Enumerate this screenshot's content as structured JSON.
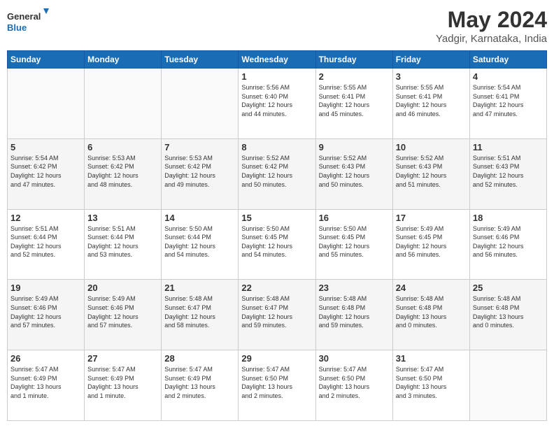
{
  "logo": {
    "line1": "General",
    "line2": "Blue"
  },
  "title": "May 2024",
  "subtitle": "Yadgir, Karnataka, India",
  "days_of_week": [
    "Sunday",
    "Monday",
    "Tuesday",
    "Wednesday",
    "Thursday",
    "Friday",
    "Saturday"
  ],
  "weeks": [
    [
      {
        "date": "",
        "info": ""
      },
      {
        "date": "",
        "info": ""
      },
      {
        "date": "",
        "info": ""
      },
      {
        "date": "1",
        "info": "Sunrise: 5:56 AM\nSunset: 6:40 PM\nDaylight: 12 hours\nand 44 minutes."
      },
      {
        "date": "2",
        "info": "Sunrise: 5:55 AM\nSunset: 6:41 PM\nDaylight: 12 hours\nand 45 minutes."
      },
      {
        "date": "3",
        "info": "Sunrise: 5:55 AM\nSunset: 6:41 PM\nDaylight: 12 hours\nand 46 minutes."
      },
      {
        "date": "4",
        "info": "Sunrise: 5:54 AM\nSunset: 6:41 PM\nDaylight: 12 hours\nand 47 minutes."
      }
    ],
    [
      {
        "date": "5",
        "info": "Sunrise: 5:54 AM\nSunset: 6:42 PM\nDaylight: 12 hours\nand 47 minutes."
      },
      {
        "date": "6",
        "info": "Sunrise: 5:53 AM\nSunset: 6:42 PM\nDaylight: 12 hours\nand 48 minutes."
      },
      {
        "date": "7",
        "info": "Sunrise: 5:53 AM\nSunset: 6:42 PM\nDaylight: 12 hours\nand 49 minutes."
      },
      {
        "date": "8",
        "info": "Sunrise: 5:52 AM\nSunset: 6:42 PM\nDaylight: 12 hours\nand 50 minutes."
      },
      {
        "date": "9",
        "info": "Sunrise: 5:52 AM\nSunset: 6:43 PM\nDaylight: 12 hours\nand 50 minutes."
      },
      {
        "date": "10",
        "info": "Sunrise: 5:52 AM\nSunset: 6:43 PM\nDaylight: 12 hours\nand 51 minutes."
      },
      {
        "date": "11",
        "info": "Sunrise: 5:51 AM\nSunset: 6:43 PM\nDaylight: 12 hours\nand 52 minutes."
      }
    ],
    [
      {
        "date": "12",
        "info": "Sunrise: 5:51 AM\nSunset: 6:44 PM\nDaylight: 12 hours\nand 52 minutes."
      },
      {
        "date": "13",
        "info": "Sunrise: 5:51 AM\nSunset: 6:44 PM\nDaylight: 12 hours\nand 53 minutes."
      },
      {
        "date": "14",
        "info": "Sunrise: 5:50 AM\nSunset: 6:44 PM\nDaylight: 12 hours\nand 54 minutes."
      },
      {
        "date": "15",
        "info": "Sunrise: 5:50 AM\nSunset: 6:45 PM\nDaylight: 12 hours\nand 54 minutes."
      },
      {
        "date": "16",
        "info": "Sunrise: 5:50 AM\nSunset: 6:45 PM\nDaylight: 12 hours\nand 55 minutes."
      },
      {
        "date": "17",
        "info": "Sunrise: 5:49 AM\nSunset: 6:45 PM\nDaylight: 12 hours\nand 56 minutes."
      },
      {
        "date": "18",
        "info": "Sunrise: 5:49 AM\nSunset: 6:46 PM\nDaylight: 12 hours\nand 56 minutes."
      }
    ],
    [
      {
        "date": "19",
        "info": "Sunrise: 5:49 AM\nSunset: 6:46 PM\nDaylight: 12 hours\nand 57 minutes."
      },
      {
        "date": "20",
        "info": "Sunrise: 5:49 AM\nSunset: 6:46 PM\nDaylight: 12 hours\nand 57 minutes."
      },
      {
        "date": "21",
        "info": "Sunrise: 5:48 AM\nSunset: 6:47 PM\nDaylight: 12 hours\nand 58 minutes."
      },
      {
        "date": "22",
        "info": "Sunrise: 5:48 AM\nSunset: 6:47 PM\nDaylight: 12 hours\nand 59 minutes."
      },
      {
        "date": "23",
        "info": "Sunrise: 5:48 AM\nSunset: 6:48 PM\nDaylight: 12 hours\nand 59 minutes."
      },
      {
        "date": "24",
        "info": "Sunrise: 5:48 AM\nSunset: 6:48 PM\nDaylight: 13 hours\nand 0 minutes."
      },
      {
        "date": "25",
        "info": "Sunrise: 5:48 AM\nSunset: 6:48 PM\nDaylight: 13 hours\nand 0 minutes."
      }
    ],
    [
      {
        "date": "26",
        "info": "Sunrise: 5:47 AM\nSunset: 6:49 PM\nDaylight: 13 hours\nand 1 minute."
      },
      {
        "date": "27",
        "info": "Sunrise: 5:47 AM\nSunset: 6:49 PM\nDaylight: 13 hours\nand 1 minute."
      },
      {
        "date": "28",
        "info": "Sunrise: 5:47 AM\nSunset: 6:49 PM\nDaylight: 13 hours\nand 2 minutes."
      },
      {
        "date": "29",
        "info": "Sunrise: 5:47 AM\nSunset: 6:50 PM\nDaylight: 13 hours\nand 2 minutes."
      },
      {
        "date": "30",
        "info": "Sunrise: 5:47 AM\nSunset: 6:50 PM\nDaylight: 13 hours\nand 2 minutes."
      },
      {
        "date": "31",
        "info": "Sunrise: 5:47 AM\nSunset: 6:50 PM\nDaylight: 13 hours\nand 3 minutes."
      },
      {
        "date": "",
        "info": ""
      }
    ]
  ]
}
